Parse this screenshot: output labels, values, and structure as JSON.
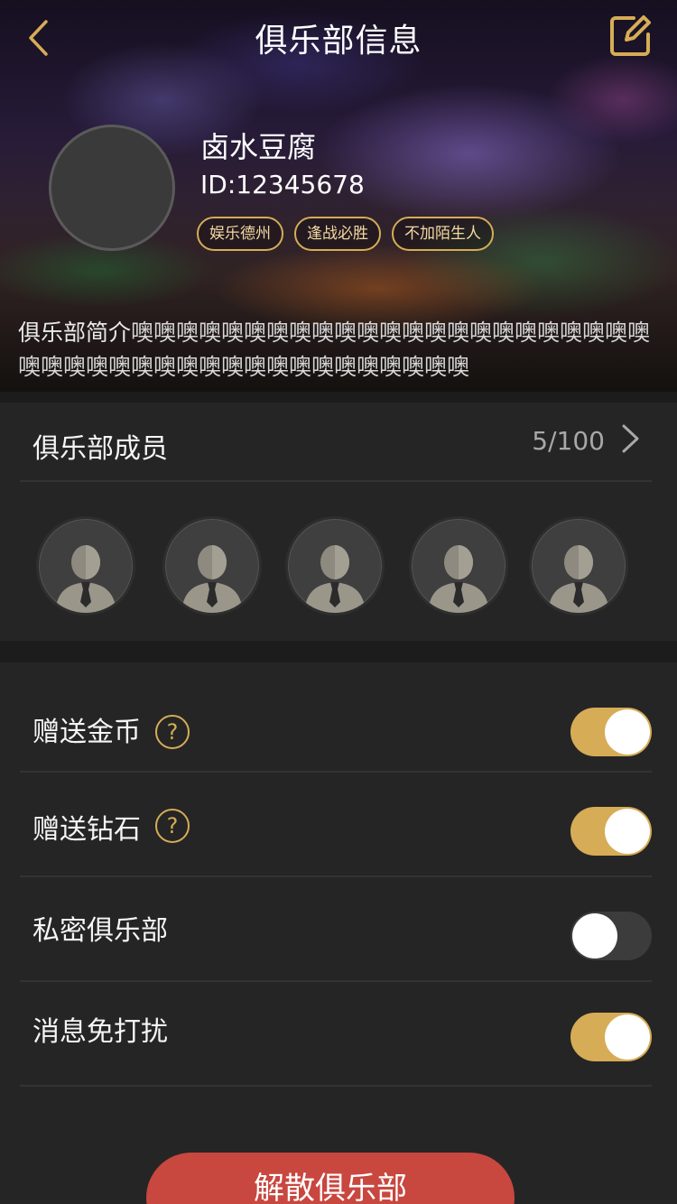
{
  "nav": {
    "title": "俱乐部信息",
    "back_icon": "chevron-left-icon",
    "edit_icon": "edit-icon"
  },
  "club": {
    "name": "卤水豆腐",
    "id_text": "ID:12345678",
    "tags": [
      "娱乐德州",
      "逢战必胜",
      "不加陌生人"
    ],
    "intro_label": "俱乐部简介",
    "intro_text": "噢噢噢噢噢噢噢噢噢噢噢噢噢噢噢噢噢噢噢噢噢噢噢噢噢噢噢噢噢噢噢噢噢噢噢噢噢噢噢噢噢噢噢"
  },
  "members": {
    "title": "俱乐部成员",
    "count": "5/100",
    "avatars": [
      "member-1",
      "member-2",
      "member-3",
      "member-4",
      "member-5"
    ]
  },
  "settings": [
    {
      "label": "赠送金币",
      "help": true,
      "enabled": true
    },
    {
      "label": "赠送钻石",
      "help": true,
      "enabled": true
    },
    {
      "label": "私密俱乐部",
      "help": false,
      "enabled": false
    },
    {
      "label": "消息免打扰",
      "help": false,
      "enabled": true
    }
  ],
  "help_glyph": "?",
  "dissolve_button": "解散俱乐部",
  "colors": {
    "accent": "#d6ac56",
    "danger": "#c8473f",
    "card": "#252525",
    "background": "#1c1c1c"
  }
}
